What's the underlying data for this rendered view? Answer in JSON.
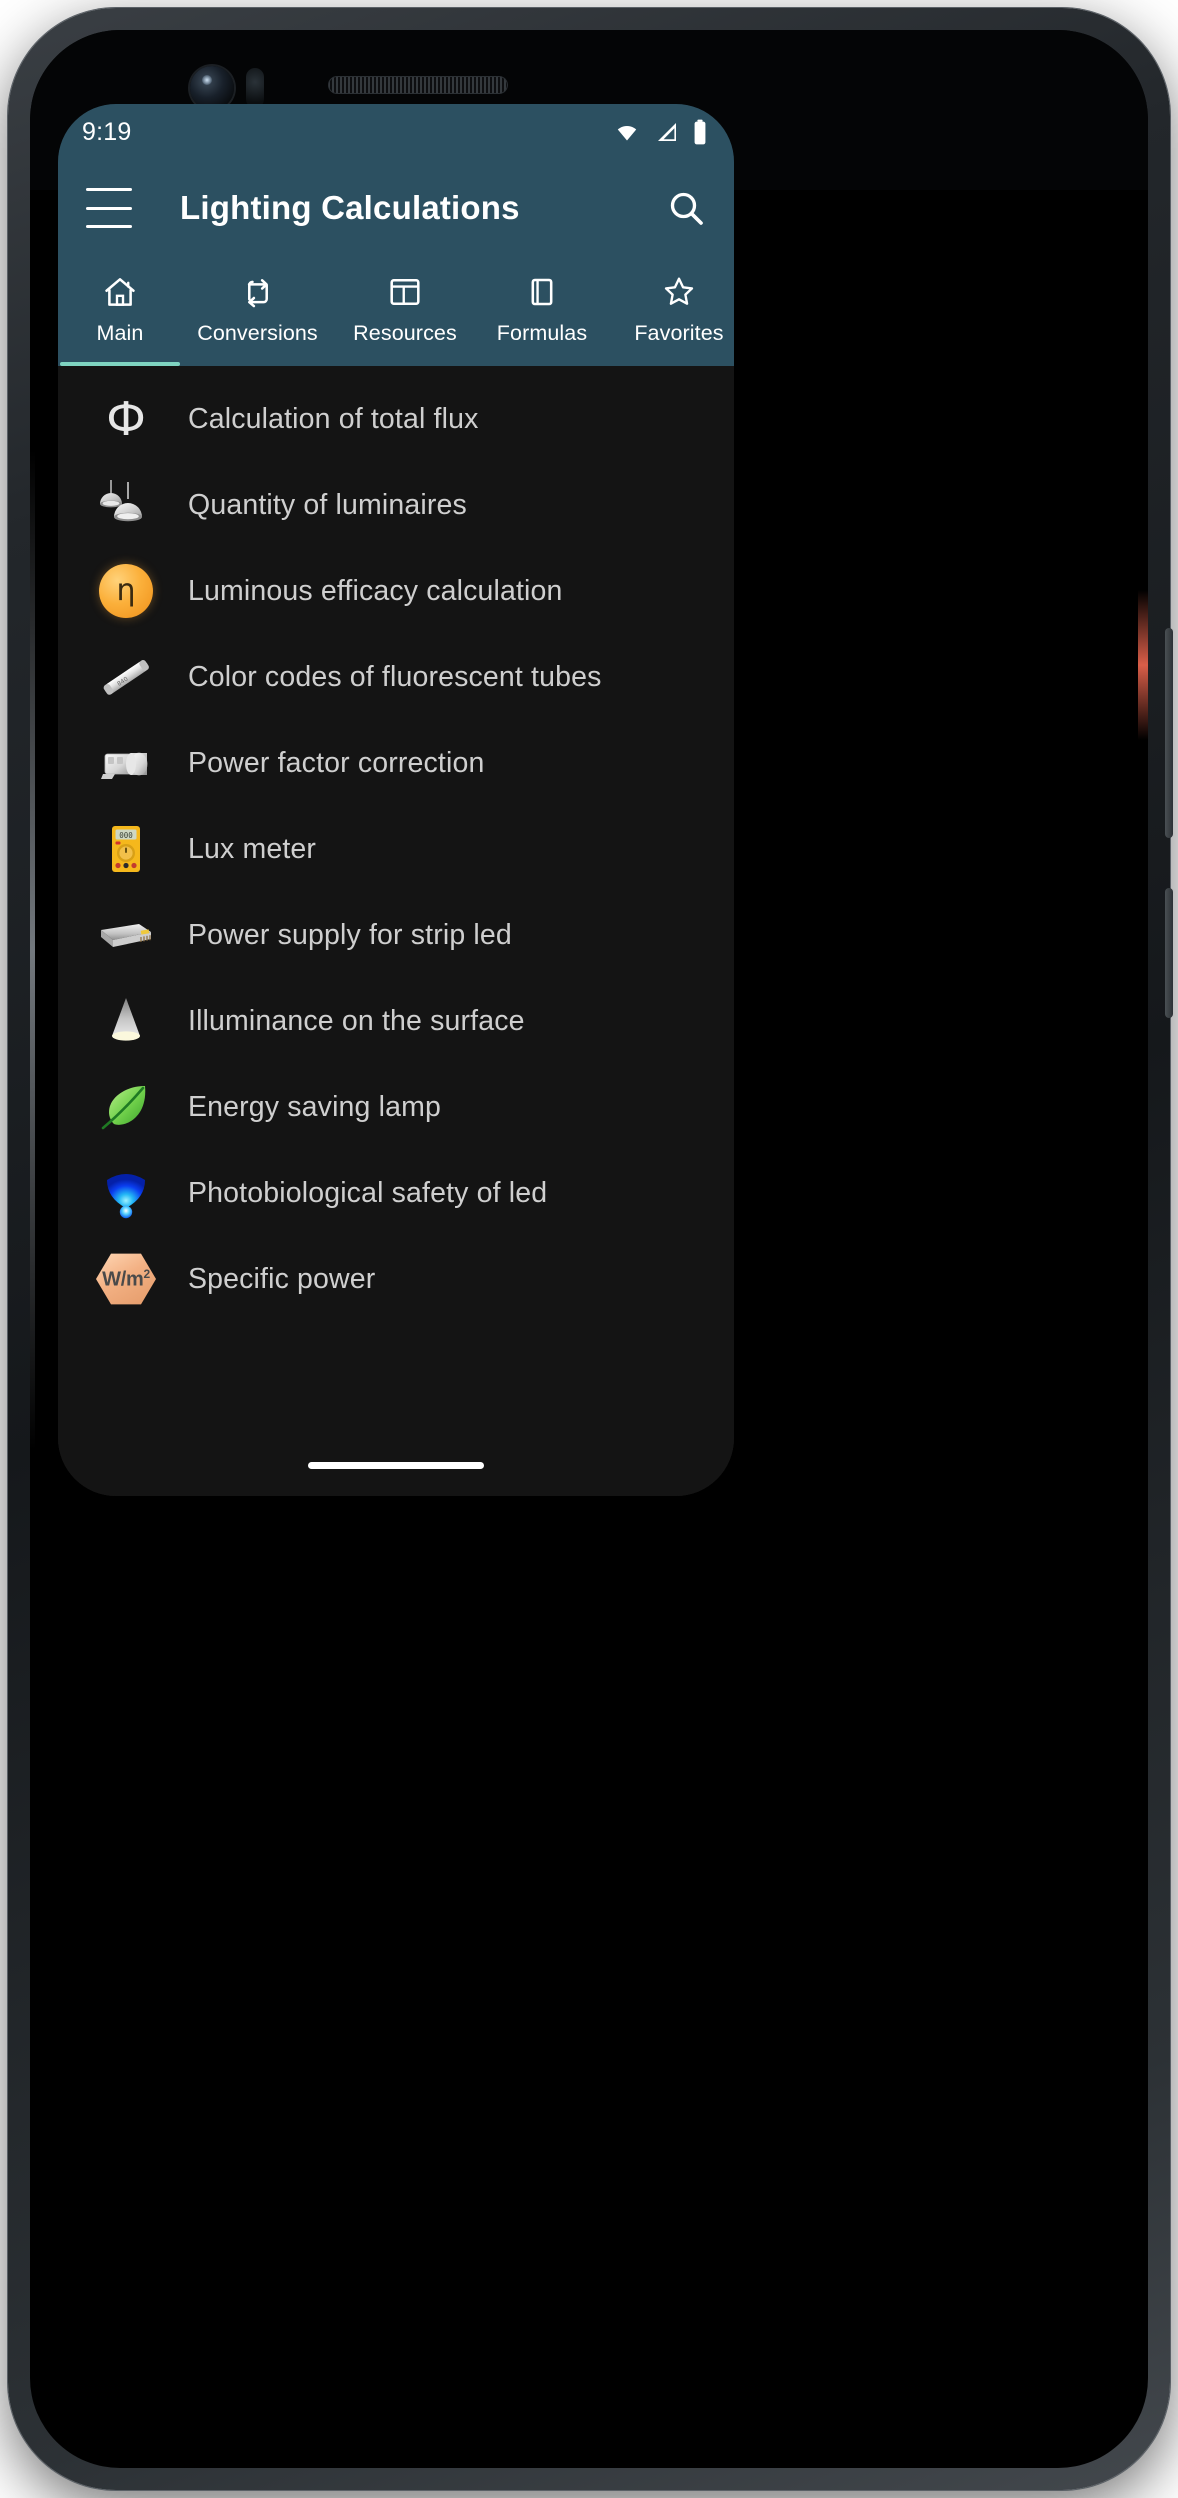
{
  "device": {
    "hardware": {
      "camera": "front-camera-lens",
      "sensor": "proximity-sensor",
      "earpiece": "earpiece-speaker"
    },
    "nav_pill": "gesture-nav-pill"
  },
  "status_bar": {
    "time": "9:19",
    "icons": [
      "wifi-icon",
      "cellular-signal-icon",
      "battery-icon"
    ],
    "background": "#2c5061"
  },
  "app_bar": {
    "menu_label": "menu-icon",
    "title": "Lighting Calculations",
    "search_label": "search-icon",
    "background": "#2c5061",
    "title_color": "#ffffff"
  },
  "tabs": {
    "active_index": 0,
    "indicator_color": "#7fd4c1",
    "items": [
      {
        "label": "Main",
        "icon": "home-icon"
      },
      {
        "label": "Conversions",
        "icon": "repeat-arrows-icon"
      },
      {
        "label": "Resources",
        "icon": "table-layout-icon"
      },
      {
        "label": "Formulas",
        "icon": "book-icon"
      },
      {
        "label": "Favorites",
        "icon": "star-icon"
      }
    ]
  },
  "list": {
    "background": "#141414",
    "text_color": "#cfcfcf",
    "items": [
      {
        "label": "Calculation of total flux",
        "icon": "phi-symbol-icon",
        "glyph": "Ф"
      },
      {
        "label": "Quantity of luminaires",
        "icon": "pendant-luminaires-icon"
      },
      {
        "label": "Luminous efficacy calculation",
        "icon": "eta-symbol-icon",
        "glyph": "η"
      },
      {
        "label": "Color codes of fluorescent tubes",
        "icon": "fluorescent-tube-icon"
      },
      {
        "label": "Power factor correction",
        "icon": "capacitor-icon"
      },
      {
        "label": "Lux meter",
        "icon": "multimeter-icon"
      },
      {
        "label": "Power supply for strip led",
        "icon": "led-power-supply-icon"
      },
      {
        "label": "Illuminance on the surface",
        "icon": "light-cone-icon"
      },
      {
        "label": "Energy saving lamp",
        "icon": "green-leaf-icon"
      },
      {
        "label": "Photobiological safety of led",
        "icon": "blue-led-glow-icon"
      },
      {
        "label": "Specific power",
        "icon": "watt-per-square-meter-icon",
        "glyph": "W/m2"
      }
    ]
  }
}
